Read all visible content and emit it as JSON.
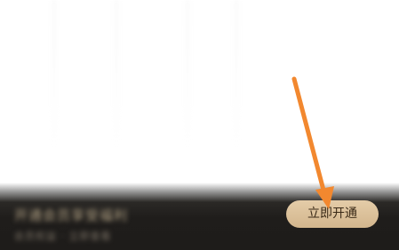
{
  "member_bar": {
    "blurred_promo_line": "开通会员享受福利",
    "blurred_sub_line": "会员权益 · 立即查看",
    "cta_label": "立即开通"
  },
  "colors": {
    "bar_background": "#1e1c1a",
    "cta_gold": "#dcc19b",
    "cta_text": "#3a2a17",
    "arrow_orange": "#f2882f"
  },
  "annotation": {
    "arrow_icon": "pointer-arrow-icon"
  }
}
